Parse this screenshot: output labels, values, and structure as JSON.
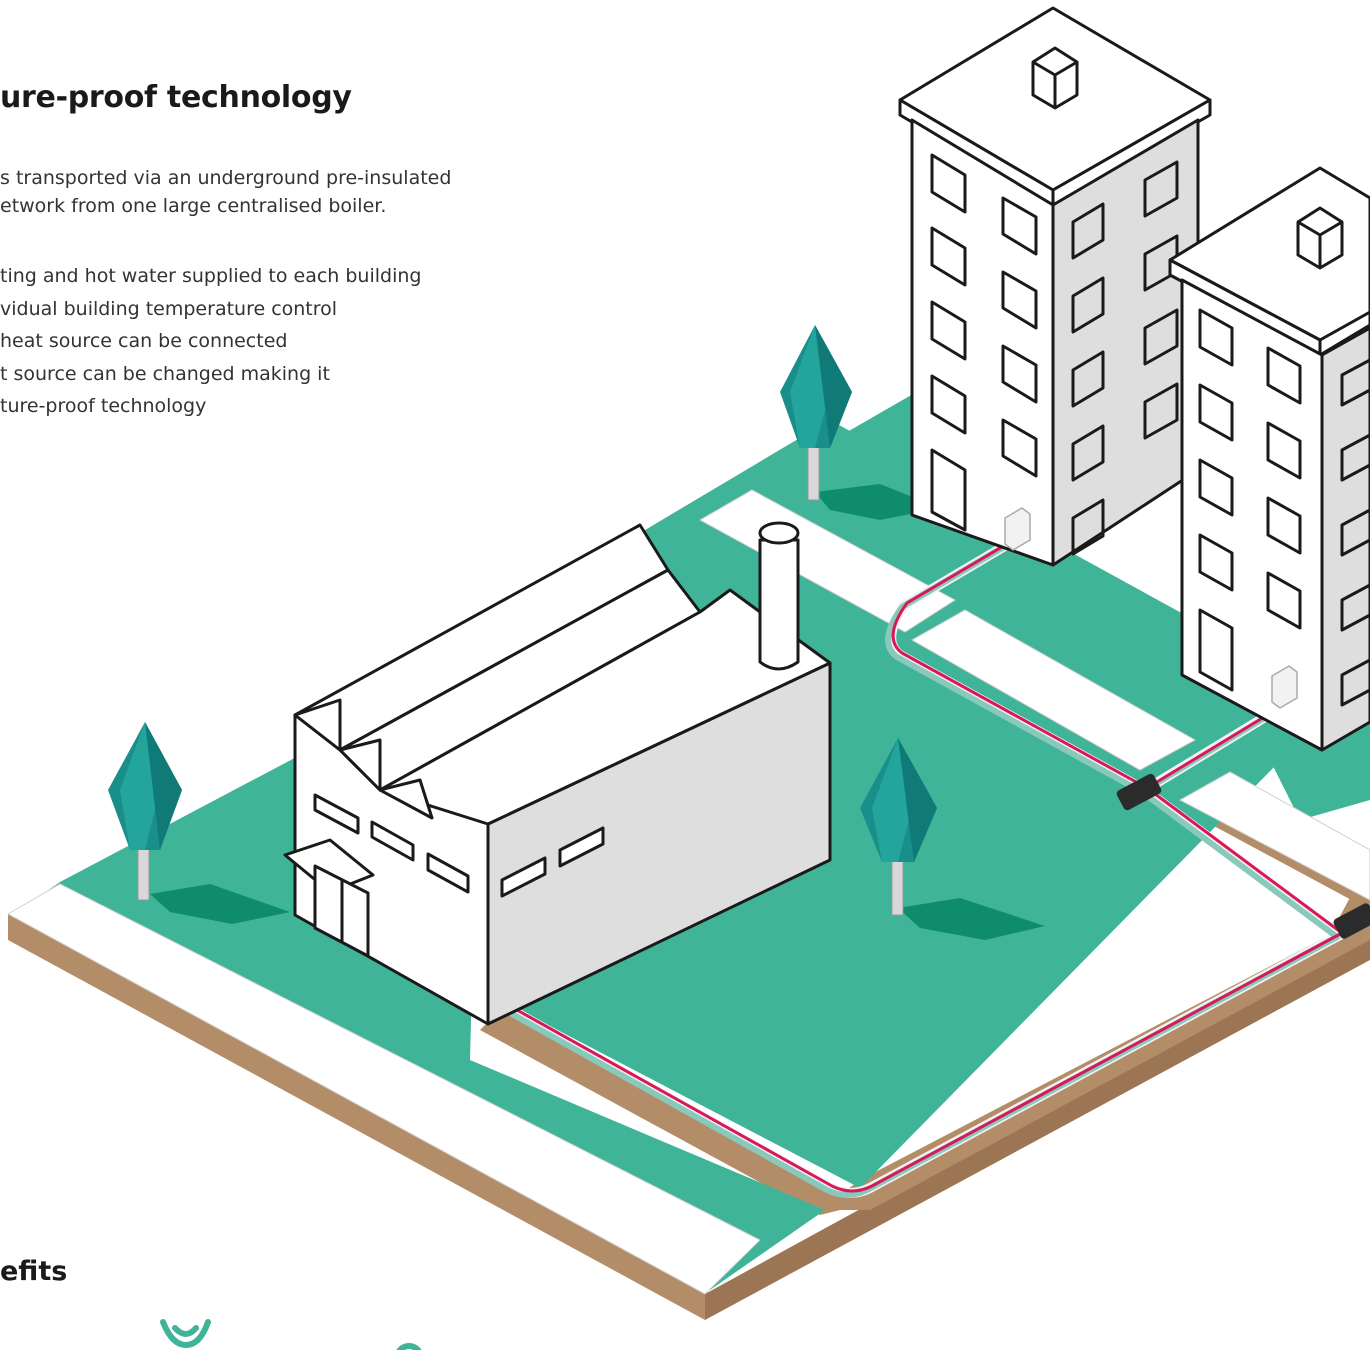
{
  "section": {
    "headline": "ure-proof technology",
    "intro_lines": [
      "s transported via an underground pre-insulated",
      "etwork from one large centralised boiler."
    ],
    "bullets": [
      "ting and hot water supplied to each building",
      "vidual building temperature control",
      " heat source can be connected",
      "t source can be changed making it",
      "ture-proof technology"
    ]
  },
  "benefits": {
    "heading": "efits",
    "icons": [
      "leaf-icon",
      "location-pin-icon"
    ]
  },
  "illustration": {
    "elements": [
      "boiler-factory",
      "apartment-building",
      "apartment-building",
      "tree",
      "tree",
      "tree",
      "district-heating-pipe"
    ],
    "colors": {
      "grass": "#3fb498",
      "grass_dark": "#2e9a7f",
      "soil": "#b38d68",
      "soil_dark": "#9c7654",
      "pavement": "#ffffff",
      "building_outline": "#1a1a1a",
      "building_side": "#dedede",
      "tree": "#1a8f8a",
      "shadow": "#0e8c6c",
      "pipe_hot": "#d9185a",
      "pipe_return": "#88c9bc",
      "heat_exchanger": "#f2f2f2"
    }
  }
}
